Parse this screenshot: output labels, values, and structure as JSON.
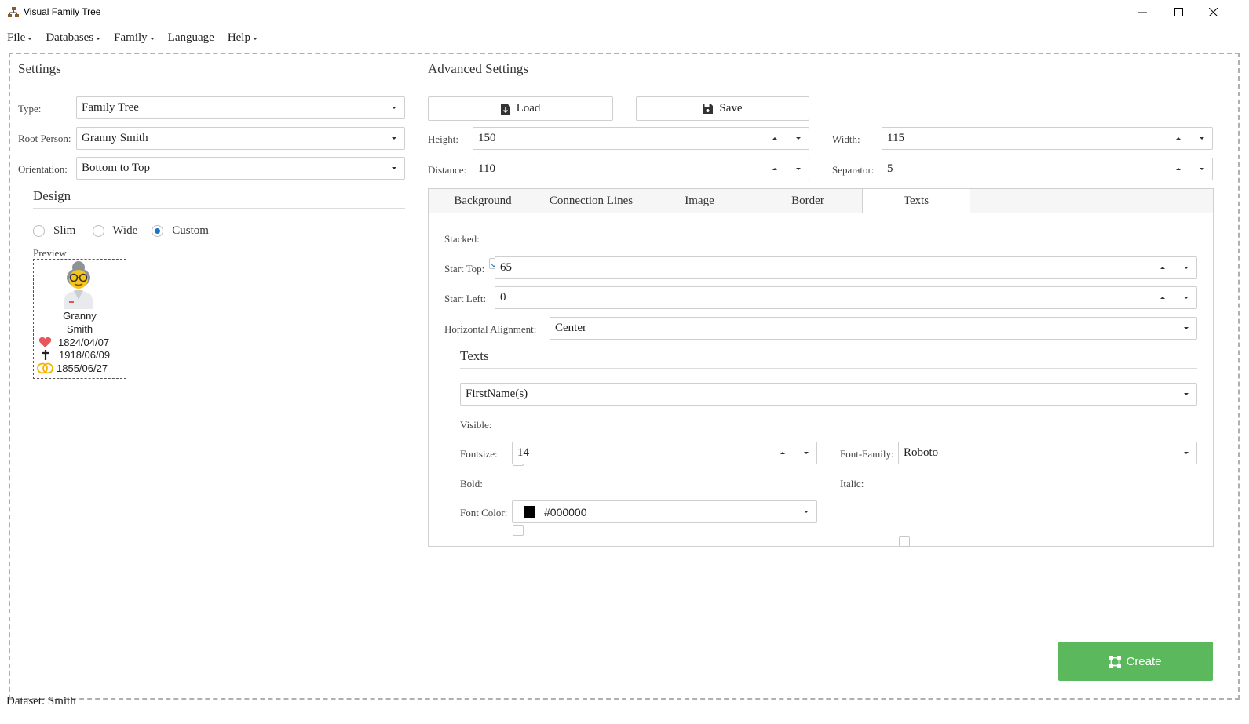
{
  "window": {
    "title": "Visual Family Tree",
    "icons": [
      "app-tree-icon",
      "minimize-icon",
      "maximize-icon",
      "close-icon"
    ]
  },
  "menu": {
    "items": [
      {
        "label": "File",
        "has_dropdown": true
      },
      {
        "label": "Databases",
        "has_dropdown": true
      },
      {
        "label": "Family",
        "has_dropdown": true
      },
      {
        "label": "Language",
        "has_dropdown": false
      },
      {
        "label": "Help",
        "has_dropdown": true
      }
    ]
  },
  "settings": {
    "title": "Settings",
    "type_label": "Type:",
    "type_value": "Family Tree",
    "root_label": "Root Person:",
    "root_value": "Granny Smith",
    "orientation_label": "Orientation:",
    "orientation_value": "Bottom to Top",
    "design": {
      "title": "Design",
      "options": [
        "Slim",
        "Wide",
        "Custom"
      ],
      "selected": "Custom"
    },
    "preview": {
      "label": "Preview",
      "first_name": "Granny",
      "last_name": "Smith",
      "birth": "1824/04/07",
      "death": "1918/06/09",
      "marriage": "1855/06/27",
      "icons": [
        "grandmother-avatar-icon",
        "heart-icon",
        "cross-icon",
        "rings-icon"
      ]
    }
  },
  "advanced": {
    "title": "Advanced Settings",
    "load_label": "Load",
    "save_label": "Save",
    "height_label": "Height:",
    "height_value": "150",
    "width_label": "Width:",
    "width_value": "115",
    "distance_label": "Distance:",
    "distance_value": "110",
    "separator_label": "Separator:",
    "separator_value": "5",
    "tabs": [
      "Background",
      "Connection Lines",
      "Image",
      "Border",
      "Texts"
    ],
    "active_tab": "Texts",
    "texts_tab": {
      "stacked_label": "Stacked:",
      "stacked": true,
      "start_top_label": "Start Top:",
      "start_top_value": "65",
      "start_left_label": "Start Left:",
      "start_left_value": "0",
      "halign_label": "Horizontal Alignment:",
      "halign_value": "Center",
      "texts_title": "Texts",
      "text_field_value": "FirstName(s)",
      "visible_label": "Visible:",
      "visible": true,
      "fontsize_label": "Fontsize:",
      "fontsize_value": "14",
      "fontfamily_label": "Font-Family:",
      "fontfamily_value": "Roboto",
      "bold_label": "Bold:",
      "bold": false,
      "italic_label": "Italic:",
      "italic": false,
      "fontcolor_label": "Font Color:",
      "fontcolor_value": "#000000",
      "fontcolor_swatch": "#000000"
    }
  },
  "create_label": "Create",
  "create_color": "#5cb85c",
  "status": {
    "dataset": "Dataset: Smith"
  }
}
